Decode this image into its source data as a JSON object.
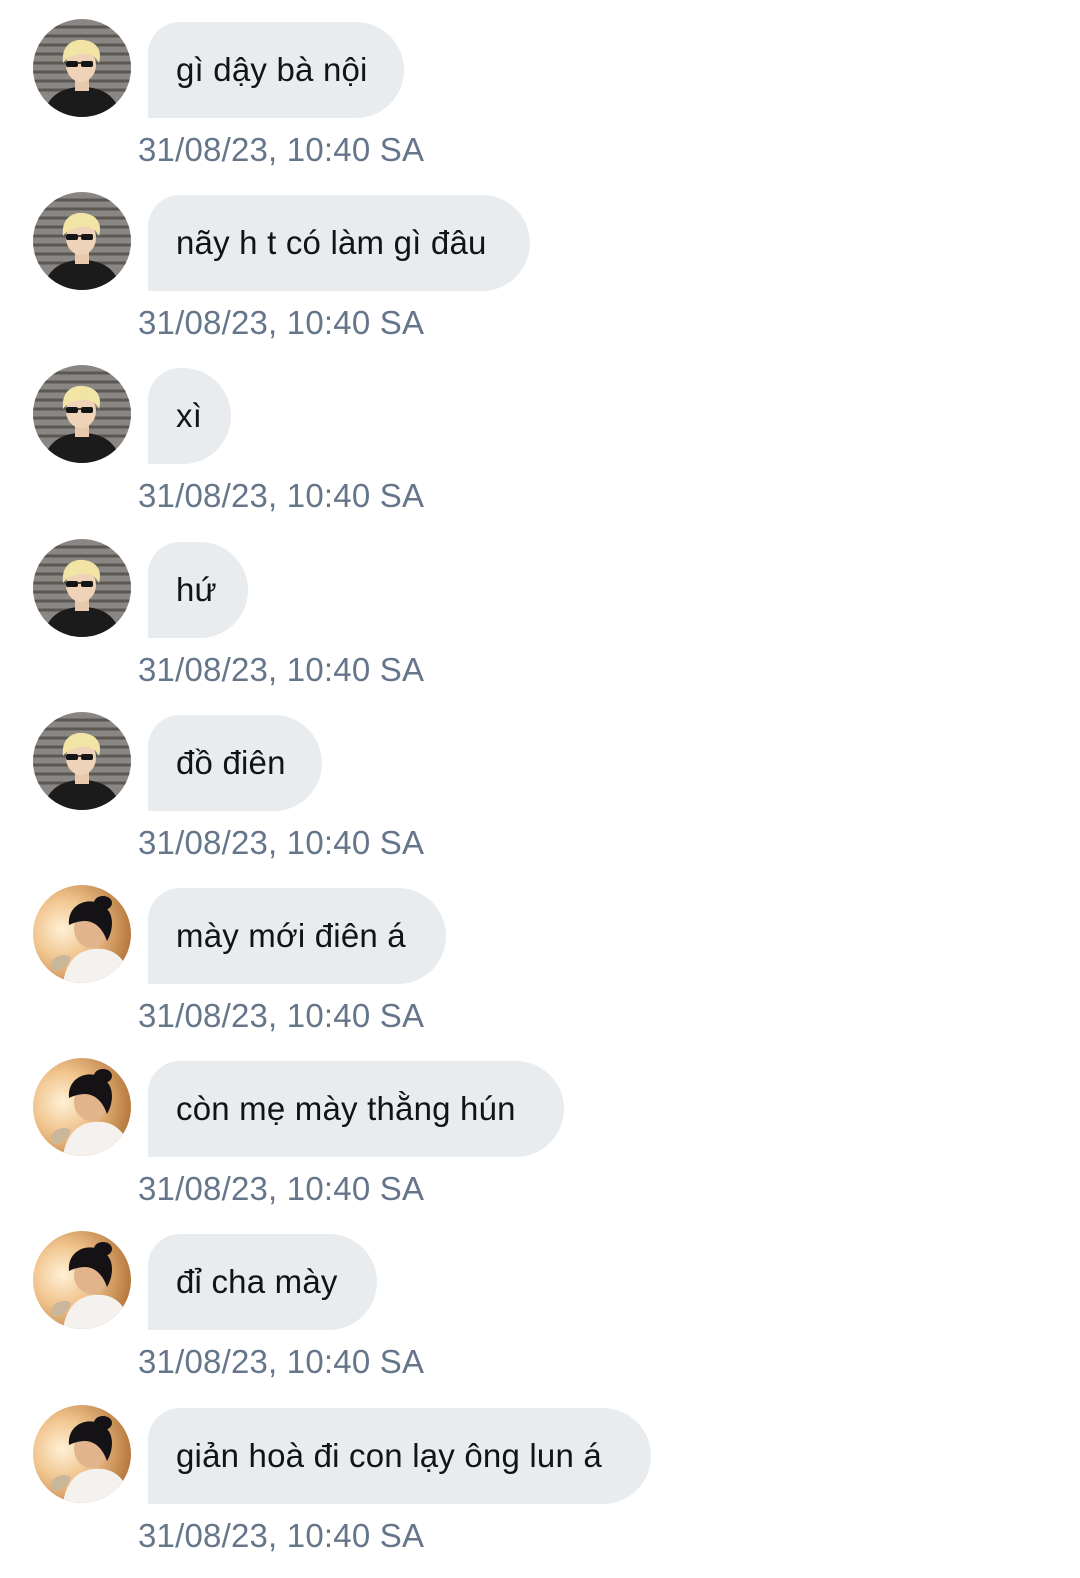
{
  "messages": [
    {
      "sender": "a",
      "avatar_icon": "avatar-blonde-sunglasses-icon",
      "text": "gì dậy bà nội",
      "time": "31/08/23, 10:40 SA"
    },
    {
      "sender": "a",
      "avatar_icon": "avatar-blonde-sunglasses-icon",
      "text": "nãy h t có làm gì đâu",
      "time": "31/08/23, 10:40 SA"
    },
    {
      "sender": "a",
      "avatar_icon": "avatar-blonde-sunglasses-icon",
      "text": "xì",
      "time": "31/08/23, 10:40 SA"
    },
    {
      "sender": "a",
      "avatar_icon": "avatar-blonde-sunglasses-icon",
      "text": "hứ",
      "time": "31/08/23, 10:40 SA"
    },
    {
      "sender": "a",
      "avatar_icon": "avatar-blonde-sunglasses-icon",
      "text": "đồ điên",
      "time": "31/08/23, 10:40 SA"
    },
    {
      "sender": "b",
      "avatar_icon": "avatar-dark-hair-warm-light-icon",
      "text": "mày mới điên á",
      "time": "31/08/23, 10:40 SA"
    },
    {
      "sender": "b",
      "avatar_icon": "avatar-dark-hair-warm-light-icon",
      "text": "còn mẹ mày thằng hún",
      "time": "31/08/23, 10:40 SA"
    },
    {
      "sender": "b",
      "avatar_icon": "avatar-dark-hair-warm-light-icon",
      "text": "đỉ cha mày",
      "time": "31/08/23, 10:40 SA"
    },
    {
      "sender": "b",
      "avatar_icon": "avatar-dark-hair-warm-light-icon",
      "text": "giản hoà đi con lạy ông lun á",
      "time": "31/08/23, 10:40 SA"
    }
  ],
  "colors": {
    "bubble_background": "#e9ecef",
    "message_text": "#101418",
    "timestamp_text": "#66768a",
    "page_background": "#ffffff"
  }
}
